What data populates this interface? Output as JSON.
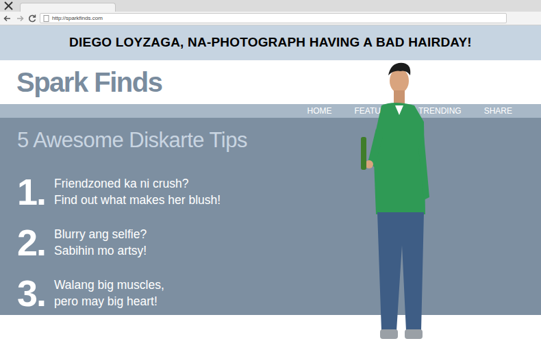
{
  "browser": {
    "url": "http://sparkfinds.com"
  },
  "headline": "DIEGO LOYZAGA, NA-PHOTOGRAPH HAVING A BAD HAIRDAY!",
  "site": {
    "logo": "Spark Finds",
    "nav": [
      {
        "label": "HOME"
      },
      {
        "label": "FEATU"
      },
      {
        "label": "TRENDING"
      },
      {
        "label": "SHARE"
      }
    ]
  },
  "article": {
    "title": "5 Awesome Diskarte Tips",
    "tips": [
      {
        "number": "1.",
        "lines": [
          "Friendzoned ka ni crush?",
          "Find out what makes her blush!"
        ]
      },
      {
        "number": "2.",
        "lines": [
          "Blurry ang selfie?",
          "Sabihin mo artsy!"
        ]
      },
      {
        "number": "3.",
        "lines": [
          "Walang big muscles,",
          "pero may big heart!"
        ]
      }
    ]
  }
}
